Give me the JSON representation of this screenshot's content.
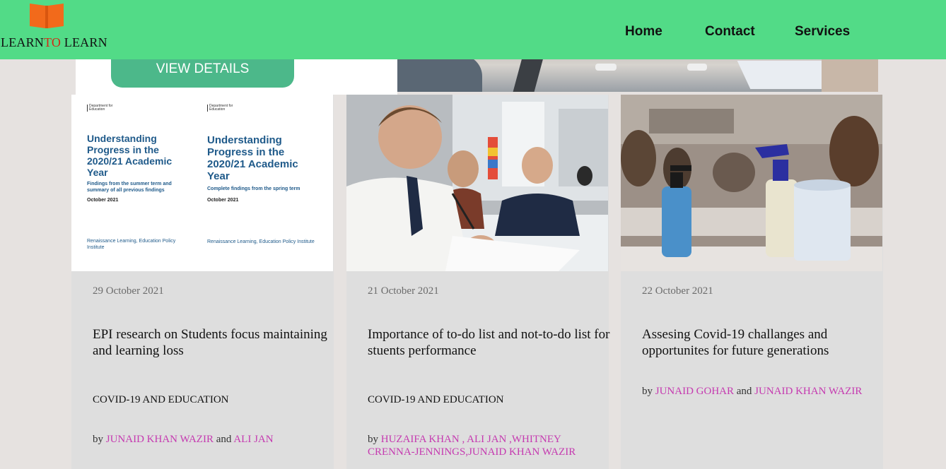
{
  "header": {
    "logo": {
      "prefix": "LEARN",
      "highlight": "TO",
      "suffix": " LEARN",
      "book_color": "#f26a1b",
      "highlight_color": "#d22a15"
    },
    "nav": [
      "Home",
      "Contact",
      "Services"
    ],
    "background": "#52db87"
  },
  "hero": {
    "button_label": "VIEW DETAILS",
    "button_color": "#4cb88a"
  },
  "cards": [
    {
      "image": {
        "type": "document-cover",
        "department": "Department for Education",
        "left": {
          "title": "Understanding Progress in the 2020/21 Academic Year",
          "subtitle": "Findings from the summer term and summary of all previous findings",
          "date": "October 2021",
          "org": "Renaissance Learning, Education Policy Institute"
        },
        "right": {
          "title": "Understanding Progress in the 2020/21 Academic Year",
          "subtitle": "Complete findings from the spring term",
          "date": "October 2021",
          "org": "Renaissance Learning, Education Policy Institute"
        }
      },
      "date": "29 October 2021",
      "title": "EPI research on Students focus maintaining and learning loss",
      "category": "COVID-19 AND EDUCATION",
      "by": "by",
      "and": "and",
      "authors": [
        "JUNAID KHAN WAZIR",
        "ALI JAN"
      ]
    },
    {
      "image": {
        "type": "photo",
        "subject": "students-writing-photo"
      },
      "date": "21 October 2021",
      "title": "Importance of to-do list and not-to-do list for stuents performance",
      "category": "COVID-19 AND EDUCATION",
      "by": "by",
      "authors_text": "HUZAIFA KHAN , ALI JAN ,WHITNEY CRENNA-JENNINGS,JUNAID KHAN WAZIR"
    },
    {
      "image": {
        "type": "photo",
        "subject": "sanitizer-classroom-photo"
      },
      "date": "22 October 2021",
      "title": "Assesing Covid-19 challanges and opportunites for future generations",
      "category": "",
      "by": "by",
      "and": "and",
      "authors": [
        "JUNAID GOHAR",
        "JUNAID KHAN WAZIR"
      ]
    }
  ],
  "colors": {
    "author_link": "#c53ab0",
    "card_bg": "#dedede",
    "page_bg": "#e6e2e0"
  }
}
